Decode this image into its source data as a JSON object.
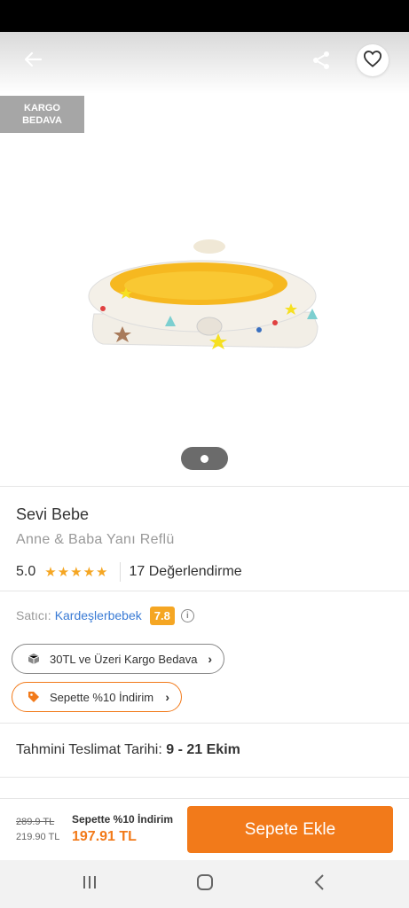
{
  "header": {
    "back_icon": "arrow-left-icon",
    "share_icon": "share-icon",
    "favorite_icon": "heart-icon"
  },
  "badge": {
    "line1": "KARGO",
    "line2": "BEDAVA"
  },
  "product": {
    "brand": "Sevi Bebe",
    "name": "Anne & Baba Yanı Reflü",
    "rating": "5.0",
    "stars": "★★★★★",
    "review_count": "17 Değerlendirme"
  },
  "seller": {
    "label": "Satıcı:",
    "name": "Kardeşlerbebek",
    "score": "7.8"
  },
  "promos": {
    "cargo": "30TL ve Üzeri Kargo Bedava",
    "discount": "Sepette %10 İndirim"
  },
  "delivery": {
    "label": "Tahmini Teslimat Tarihi:",
    "range": "9 - 21 Ekim"
  },
  "pricing": {
    "old_price": "289.9 TL",
    "mid_price": "219.90 TL",
    "campaign_label": "Sepette %10 İndirim",
    "final_price": "197.91 TL",
    "add_to_cart": "Sepete Ekle"
  },
  "colors": {
    "accent": "#f27a1a",
    "star": "#f5a623",
    "seller_link": "#3a7bd5"
  }
}
